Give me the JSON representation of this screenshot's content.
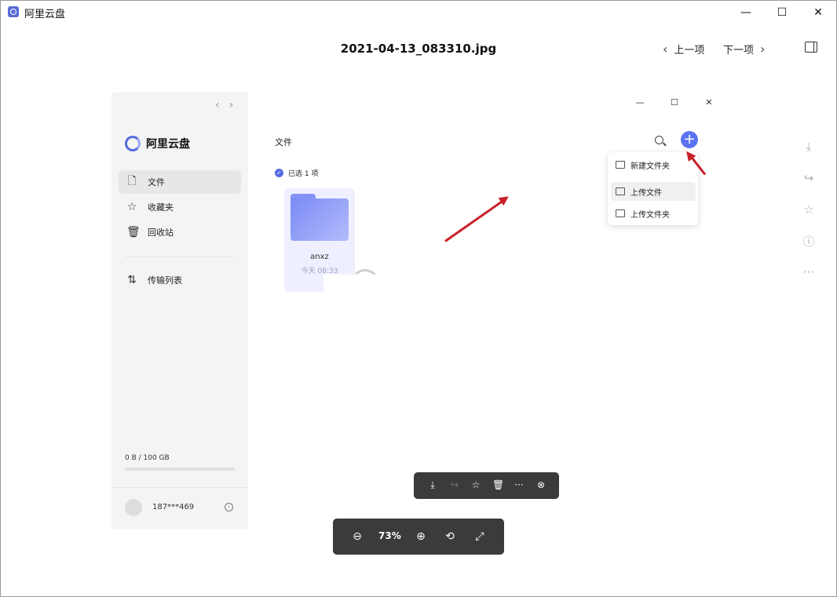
{
  "window": {
    "title": "阿里云盘",
    "minimize": "—",
    "maximize": "☐",
    "close": "✕"
  },
  "viewer": {
    "filename": "2021-04-13_083310.jpg",
    "prev_label": "上一项",
    "next_label": "下一项"
  },
  "right_actions": [
    "download-icon",
    "share-icon",
    "star-icon",
    "info-icon",
    "more-icon"
  ],
  "embedded_app": {
    "brand": "阿里云盘",
    "sidebar": {
      "items": [
        {
          "label": "文件",
          "icon": "file-icon",
          "active": true
        },
        {
          "label": "收藏夹",
          "icon": "star-icon",
          "active": false
        },
        {
          "label": "回收站",
          "icon": "trash-icon",
          "active": false
        },
        {
          "label": "传输列表",
          "icon": "transfer-icon",
          "active": false
        }
      ],
      "storage": "0 B / 100 GB",
      "storage_used_fraction": 0.0,
      "user": "187***469"
    },
    "main": {
      "breadcrumb": "文件",
      "selection": "已选 1 项",
      "file_card": {
        "name": "anxz",
        "date": "今天 08:33"
      }
    },
    "add_menu": {
      "items": [
        {
          "label": "新建文件夹",
          "highlighted": false
        },
        {
          "label": "上传文件",
          "highlighted": true
        },
        {
          "label": "上传文件夹",
          "highlighted": false
        }
      ]
    },
    "selection_toolbar": [
      "download-icon",
      "share-icon",
      "star-icon",
      "trash-icon",
      "more-icon",
      "close-icon"
    ]
  },
  "zoom": {
    "level": "73%"
  },
  "colors": {
    "accent": "#5a74ef",
    "annotation_arrow": "#c8202a",
    "toolbar_bg": "#3a3b3d"
  }
}
